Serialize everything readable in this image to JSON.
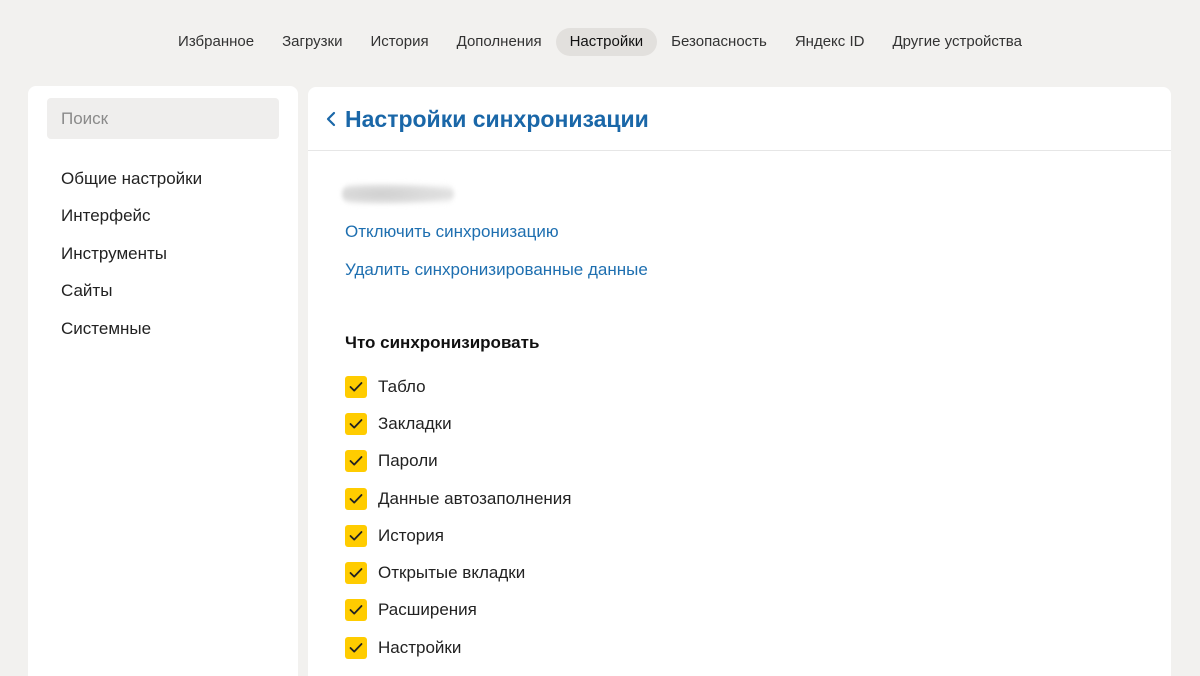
{
  "topnav": {
    "tabs": [
      {
        "label": "Избранное",
        "active": false
      },
      {
        "label": "Загрузки",
        "active": false
      },
      {
        "label": "История",
        "active": false
      },
      {
        "label": "Дополнения",
        "active": false
      },
      {
        "label": "Настройки",
        "active": true
      },
      {
        "label": "Безопасность",
        "active": false
      },
      {
        "label": "Яндекс ID",
        "active": false
      },
      {
        "label": "Другие устройства",
        "active": false
      }
    ]
  },
  "sidebar": {
    "search_placeholder": "Поиск",
    "items": [
      {
        "label": "Общие настройки"
      },
      {
        "label": "Интерфейс"
      },
      {
        "label": "Инструменты"
      },
      {
        "label": "Сайты"
      },
      {
        "label": "Системные"
      }
    ]
  },
  "main": {
    "back_icon": "chevron-left-icon",
    "title": "Настройки синхронизации",
    "disable_sync_link": "Отключить синхронизацию",
    "delete_data_link": "Удалить синхронизированные данные",
    "sync_section_title": "Что синхронизировать",
    "sync_items": [
      {
        "label": "Табло",
        "checked": true
      },
      {
        "label": "Закладки",
        "checked": true
      },
      {
        "label": "Пароли",
        "checked": true
      },
      {
        "label": "Данные автозаполнения",
        "checked": true
      },
      {
        "label": "История",
        "checked": true
      },
      {
        "label": "Открытые вкладки",
        "checked": true
      },
      {
        "label": "Расширения",
        "checked": true
      },
      {
        "label": "Настройки",
        "checked": true
      }
    ]
  },
  "colors": {
    "accent_link": "#1e6fb0",
    "checkbox": "#ffcc00",
    "background": "#f2f1ef"
  }
}
